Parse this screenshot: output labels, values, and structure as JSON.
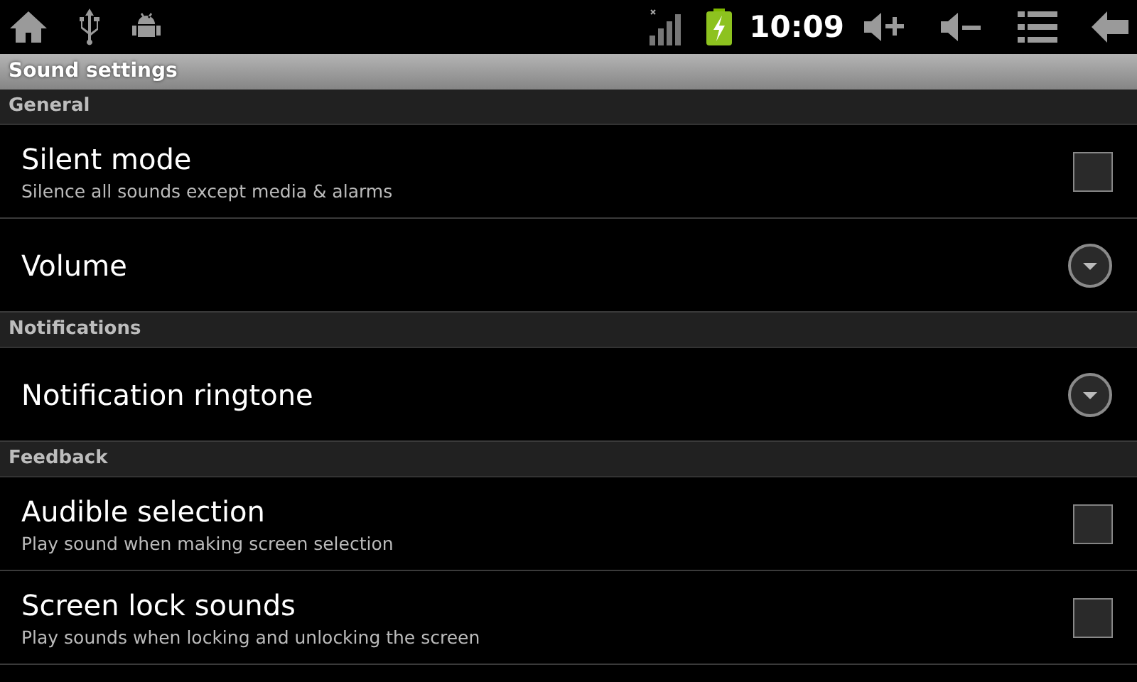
{
  "status_bar": {
    "time": "10:09"
  },
  "title": "Sound settings",
  "sections": [
    {
      "header": "General",
      "items": [
        {
          "kind": "checkbox",
          "title": "Silent mode",
          "summary": "Silence all sounds except media & alarms",
          "checked": false
        },
        {
          "kind": "dropdown",
          "title": "Volume"
        }
      ]
    },
    {
      "header": "Notifications",
      "items": [
        {
          "kind": "dropdown",
          "title": "Notification ringtone"
        }
      ]
    },
    {
      "header": "Feedback",
      "items": [
        {
          "kind": "checkbox",
          "title": "Audible selection",
          "summary": "Play sound when making screen selection",
          "checked": false
        },
        {
          "kind": "checkbox",
          "title": "Screen lock sounds",
          "summary": "Play sounds when locking and unlocking the screen",
          "checked": false
        }
      ]
    }
  ]
}
